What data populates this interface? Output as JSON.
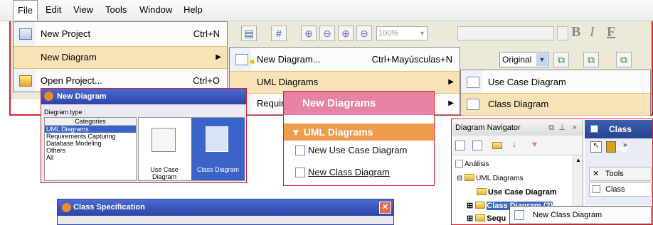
{
  "menubar": {
    "items": [
      "File",
      "Edit",
      "View",
      "Tools",
      "Window",
      "Help"
    ]
  },
  "toolbar": {
    "zoom": "100%",
    "font_bold": "B",
    "font_italic": "I",
    "font_f": "F",
    "original_select": "Original"
  },
  "file_menu": {
    "new_project": "New Project",
    "new_project_shortcut": "Ctrl+N",
    "new_diagram": "New Diagram",
    "open_project": "Open Project...",
    "open_project_shortcut": "Ctrl+O"
  },
  "new_diagram_menu": {
    "new_diagram": "New Diagram...",
    "new_diagram_shortcut": "Ctrl+Mayúsculas+N",
    "uml_diagrams": "UML Diagrams",
    "requirements": "Requir"
  },
  "uml_menu": {
    "use_case": "Use Case Diagram",
    "class": "Class Diagram"
  },
  "new_diagram_dialog": {
    "title": "New Diagram",
    "diagram_type_label": "Diagram type :",
    "categories": [
      "Categories",
      "UML Diagrams",
      "Requirements Capturing",
      "Database Modeling",
      "Others",
      "All"
    ],
    "options": [
      "Use Case Diagram",
      "Class Diagram"
    ]
  },
  "new_diagrams_panel": {
    "header": "New Diagrams",
    "section": "▼ UML Diagrams",
    "items": [
      "New Use Case Diagram",
      "New Class Diagram"
    ]
  },
  "diagram_navigator": {
    "title": "Diagram Navigator",
    "title_buttons": [
      "❐",
      " ⊣",
      "×"
    ],
    "tree": [
      "Análisis",
      "UML Diagrams",
      "Use Case Diagram",
      "Class Diagram (2)",
      "Sequ"
    ],
    "context_item": "New Class Diagram"
  },
  "class_diagram_panel": {
    "title": "Class Diag",
    "tools_label": "Tools",
    "class_label": "Class"
  },
  "class_spec_dialog": {
    "title": "Class Specification",
    "close": "✕"
  },
  "colors": {
    "highlight": "#f7e3b7",
    "frame_red": "#d2232a",
    "pink": "#e783a2",
    "orange": "#ee9b4c",
    "dialog_blue": "#2c45a7"
  }
}
